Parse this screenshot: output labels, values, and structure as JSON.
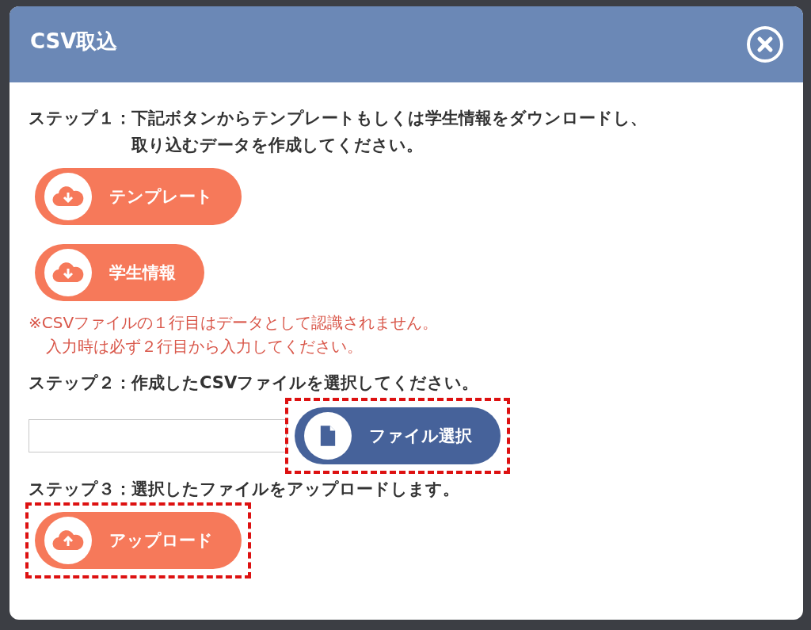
{
  "dialog": {
    "title": "CSV取込"
  },
  "step1": {
    "label": "ステップ１：",
    "lines": [
      "下記ボタンからテンプレートもしくは学生情報をダウンロードし、",
      "取り込むデータを作成してください。"
    ]
  },
  "download_buttons": [
    {
      "label": "テンプレート",
      "kind": "download",
      "highlighted": false
    },
    {
      "label": "学生情報",
      "kind": "download",
      "highlighted": false
    }
  ],
  "note": {
    "lines": [
      "※CSVファイルの１行目はデータとして認識されません。",
      "入力時は必ず２行目から入力してください。"
    ]
  },
  "step2": {
    "label": "ステップ２：",
    "lines": [
      "作成したCSVファイルを選択してください。"
    ]
  },
  "file_button": {
    "label": "ファイル選択",
    "kind": "file",
    "highlighted": true
  },
  "step3": {
    "label": "ステップ３：",
    "lines": [
      "選択したファイルをアップロードします。"
    ]
  },
  "upload_button": {
    "label": "アップロード",
    "kind": "upload",
    "highlighted": true
  }
}
